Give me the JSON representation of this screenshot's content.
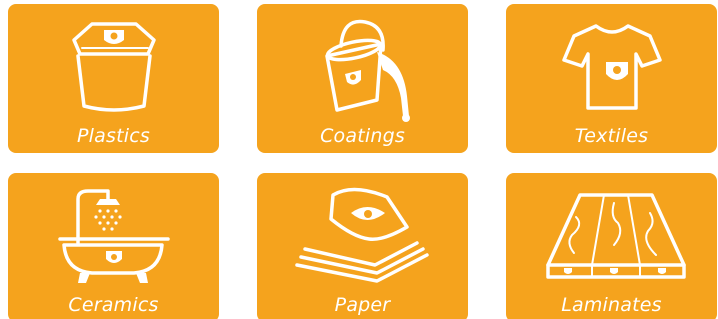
{
  "page": {
    "accent_color": "#f5a31d",
    "text_color": "#ffffff"
  },
  "tiles": [
    {
      "label": "Plastics",
      "icon": "plastic-container-icon"
    },
    {
      "label": "Coatings",
      "icon": "paint-bucket-icon"
    },
    {
      "label": "Textiles",
      "icon": "t-shirt-icon"
    },
    {
      "label": "Ceramics",
      "icon": "bathtub-icon"
    },
    {
      "label": "Paper",
      "icon": "paper-stack-icon"
    },
    {
      "label": "Laminates",
      "icon": "wood-planks-icon"
    }
  ]
}
